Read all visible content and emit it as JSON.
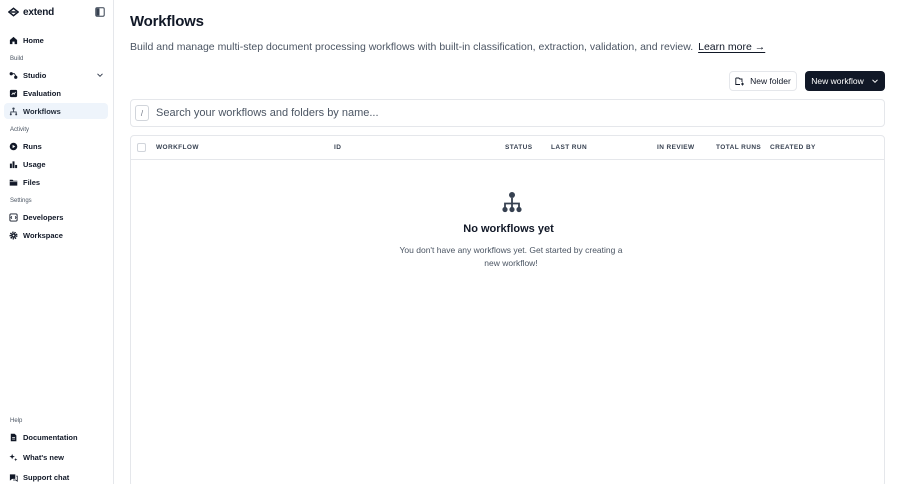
{
  "brand": {
    "name": "extend"
  },
  "sidebar": {
    "home": "Home",
    "sections": {
      "build": "Build",
      "activity": "Activity",
      "settings": "Settings",
      "help": "Help"
    },
    "build_items": [
      "Studio",
      "Evaluation",
      "Workflows"
    ],
    "activity_items": [
      "Runs",
      "Usage",
      "Files"
    ],
    "settings_items": [
      "Developers",
      "Workspace"
    ],
    "help_items": [
      "Documentation",
      "What's new",
      "Support chat"
    ],
    "active": "Workflows"
  },
  "page": {
    "title": "Workflows",
    "description": "Build and manage multi-step document processing workflows with built-in classification, extraction, validation, and review.",
    "learn_more": "Learn more →",
    "new_folder": "New folder",
    "new_workflow": "New workflow"
  },
  "search": {
    "shortcut": "/",
    "placeholder": "Search your workflows and folders by name..."
  },
  "table": {
    "columns": [
      "Workflow",
      "ID",
      "Status",
      "Last Run",
      "In Review",
      "Total Runs",
      "Created By"
    ]
  },
  "empty_state": {
    "title": "No workflows yet",
    "description": "You don't have any workflows yet. Get started by creating a new workflow!",
    "icon": "workflow-tree-icon"
  },
  "colors": {
    "accent_bg": "#eef4fb",
    "primary_button": "#111827",
    "border": "#e5e7eb"
  }
}
